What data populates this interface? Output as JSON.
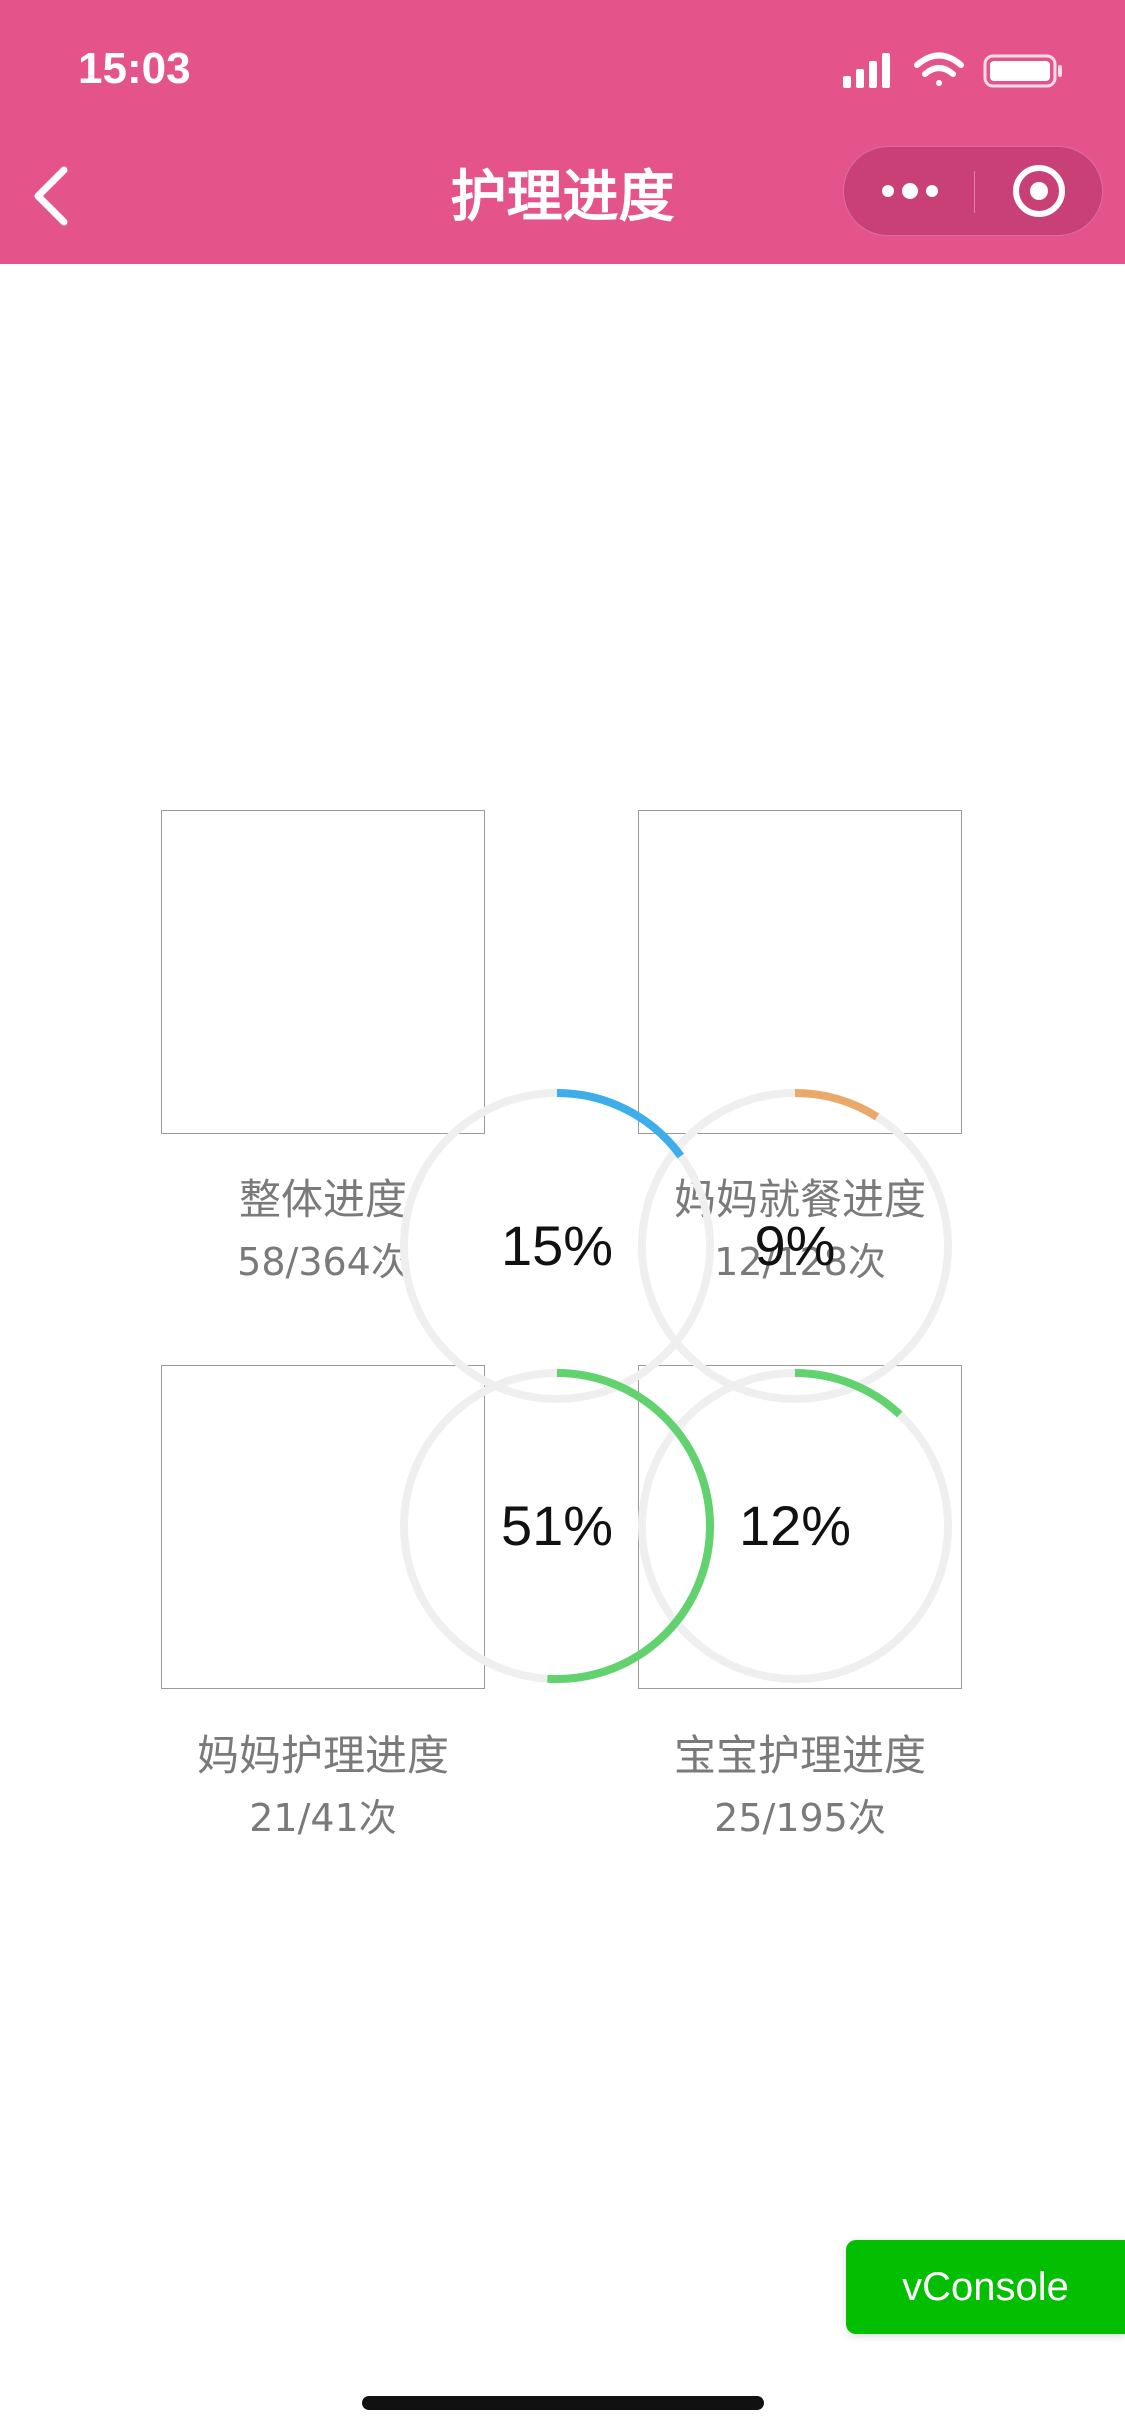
{
  "status_bar": {
    "time": "15:03"
  },
  "nav": {
    "title": "护理进度",
    "back_icon": "chevron-left-icon",
    "more_icon": "more-dots-icon",
    "close_icon": "target-circle-icon"
  },
  "colors": {
    "header_bg": "#e4548b",
    "ring_track": "#efefef",
    "ring_blue": "#3daee9",
    "ring_orange": "#e9a96a",
    "ring_green": "#62d26f",
    "vconsole_bg": "#04be02"
  },
  "cards": [
    {
      "label": "整体进度",
      "count": "58/364次",
      "percent_text": "15%",
      "progress": 0.15,
      "color": "#3daee9"
    },
    {
      "label": "妈妈就餐进度",
      "count": "12/128次",
      "percent_text": "9%",
      "progress": 0.09,
      "color": "#e9a96a"
    },
    {
      "label": "妈妈护理进度",
      "count": "21/41次",
      "percent_text": "51%",
      "progress": 0.51,
      "color": "#62d26f"
    },
    {
      "label": "宝宝护理进度",
      "count": "25/195次",
      "percent_text": "12%",
      "progress": 0.12,
      "color": "#62d26f"
    }
  ],
  "vconsole": {
    "label": "vConsole"
  }
}
